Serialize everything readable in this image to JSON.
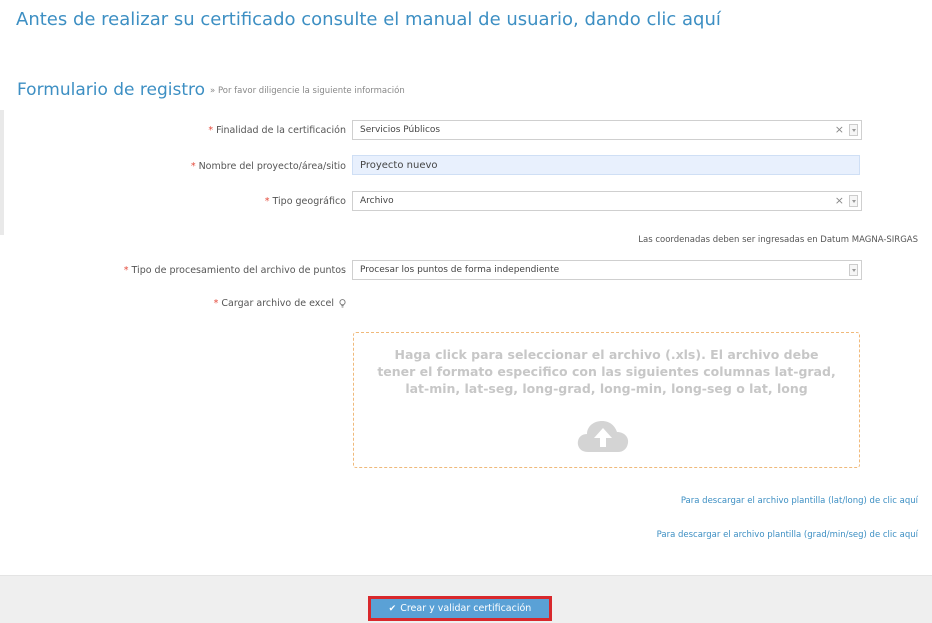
{
  "intro": {
    "text": "Antes de realizar su certificado consulte el manual de usuario, dando clic aquí"
  },
  "form": {
    "title": "Formulario de registro",
    "subtitle": "» Por favor diligencie la siguiente información",
    "required_mark": "*",
    "fields": {
      "finalidad": {
        "label": "Finalidad de la certificación",
        "value": "Servicios Públicos",
        "clear": "×"
      },
      "nombre": {
        "label": "Nombre del proyecto/área/sitio",
        "value": "Proyecto nuevo"
      },
      "tipo_geo": {
        "label": "Tipo geográfico",
        "value": "Archivo",
        "clear": "×"
      },
      "procesamiento": {
        "label": "Tipo de procesamiento del archivo de puntos",
        "value": "Procesar los puntos de forma independiente"
      },
      "excel": {
        "label": "Cargar archivo de excel"
      }
    },
    "coords_note": "Las coordenadas deben ser ingresadas en Datum MAGNA-SIRGAS",
    "dropzone": {
      "text": "Haga click para seleccionar el archivo (.xls). El archivo debe tener el formato especifico con las siguientes columnas lat-grad, lat-min, lat-seg, long-grad, long-min, long-seg o lat, long",
      "icon": "cloud-upload-icon"
    },
    "links": {
      "template_latlong": "Para descargar el archivo plantilla (lat/long) de clic aquí",
      "template_grad": "Para descargar el archivo plantilla (grad/min/seg) de clic aquí"
    }
  },
  "footer": {
    "submit_label": "Crear y validar certificación",
    "submit_icon": "✔"
  },
  "colors": {
    "accent": "#3d8fc3",
    "required": "#e44b3c",
    "button": "#5aa1d6",
    "highlight_border": "#d8282c",
    "dropzone_border": "#f0b97a"
  }
}
